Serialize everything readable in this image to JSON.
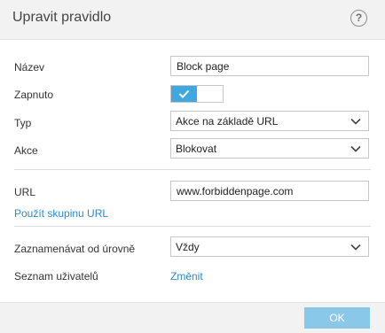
{
  "dialog": {
    "title": "Upravit pravidlo",
    "help_label": "?"
  },
  "form": {
    "name_label": "Název",
    "name_value": "Block page",
    "enabled_label": "Zapnuto",
    "enabled": true,
    "type_label": "Typ",
    "type_value": "Akce na základě URL",
    "action_label": "Akce",
    "action_value": "Blokovat",
    "url_label": "URL",
    "url_value": "www.forbiddenpage.com",
    "url_group_link": "Použít skupinu URL",
    "log_label": "Zaznamenávat od úrovně",
    "log_value": "Vždy",
    "users_label": "Seznam uživatelů",
    "users_link": "Změnit"
  },
  "footer": {
    "ok_label": "OK"
  },
  "colors": {
    "accent": "#3fa8e0",
    "link": "#2a8bc8",
    "ok_button": "#8ac8ea"
  },
  "icons": {
    "help": "help-icon",
    "toggle": "check-icon",
    "dropdown": "chevron-down-icon"
  }
}
